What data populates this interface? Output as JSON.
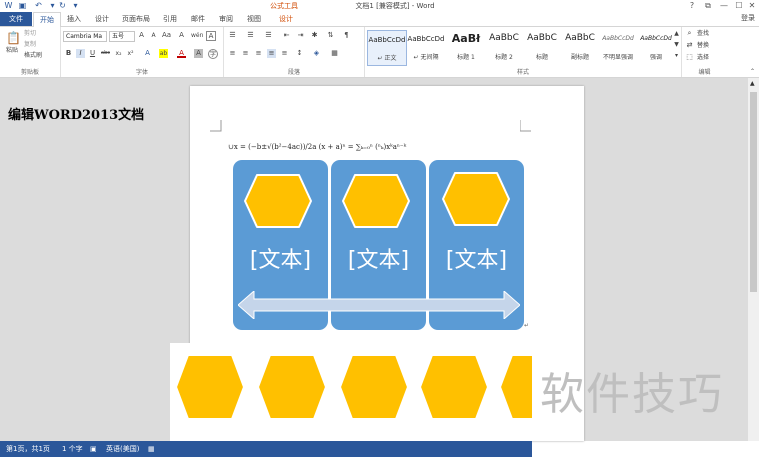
{
  "titlebar": {
    "context_tab": "公式工具",
    "doc_title": "文档1 [兼容模式] - Word",
    "help": "?",
    "restore": "⧉",
    "minimize": "—",
    "maximize": "☐",
    "close": "✕"
  },
  "tabs": {
    "file": "文件",
    "home": "开始",
    "insert": "插入",
    "design": "设计",
    "layout": "页面布局",
    "references": "引用",
    "mailings": "邮件",
    "review": "审阅",
    "view": "视图",
    "eq_design": "设计",
    "signin": "登录"
  },
  "ribbon": {
    "clipboard": {
      "paste": "粘贴",
      "cut": "剪切",
      "copy": "复制",
      "format_painter": "格式刷",
      "label": "剪贴板"
    },
    "font": {
      "name": "Cambria Ma",
      "size": "五号",
      "bold": "B",
      "italic": "I",
      "underline": "U",
      "strike": "abc",
      "sub": "x₂",
      "sup": "x²",
      "grow": "A",
      "shrink": "A",
      "aa": "Aa",
      "clear": "A",
      "phonetic": "wén",
      "border": "A",
      "color": "A",
      "highlight": "ab",
      "label": "字体"
    },
    "paragraph": {
      "label": "段落"
    },
    "styles": {
      "label": "样式",
      "items": [
        {
          "preview": "AaBbCcDd",
          "name": "↵ 正文"
        },
        {
          "preview": "AaBbCcDd",
          "name": "↵ 无间隔"
        },
        {
          "preview": "AaBł",
          "name": "标题 1"
        },
        {
          "preview": "AaBbC",
          "name": "标题 2"
        },
        {
          "preview": "AaBbC",
          "name": "标题"
        },
        {
          "preview": "AaBbC",
          "name": "副标题"
        },
        {
          "preview": "AaBbCcDd",
          "name": "不明显强调"
        },
        {
          "preview": "AaBbCcDd",
          "name": "强调"
        }
      ]
    },
    "editing": {
      "find": "查找",
      "replace": "替换",
      "select": "选择",
      "label": "编辑"
    }
  },
  "document": {
    "left_heading": "编辑WORD2013文档",
    "formula": "∪x = (−b±√(b²−4ac))/2a   (x + a)ⁿ = ∑ₖ₌₀ⁿ (ⁿₖ)xᵏaⁿ⁻ᵏ",
    "panels": [
      {
        "text": "[文本]"
      },
      {
        "text": "[文本]"
      },
      {
        "text": "[文本]"
      }
    ],
    "watermark": "软件技巧"
  },
  "statusbar": {
    "page": "第1页，共1页",
    "words": "1 个字",
    "lang": "英语(美国)"
  },
  "colors": {
    "word_blue": "#2b579a",
    "panel_blue": "#5b9bd5",
    "hex_yellow": "#ffc000",
    "context_orange": "#d04a02"
  }
}
